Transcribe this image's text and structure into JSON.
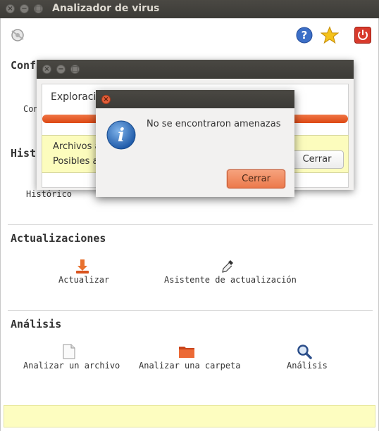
{
  "window": {
    "title": "Analizador de virus"
  },
  "header": {
    "icons": [
      "settings-icon",
      "help-icon",
      "favorite-star-icon",
      "power-icon"
    ]
  },
  "sections": {
    "configuracion": {
      "title_fragment": "Conf",
      "item_fragment": "Con"
    },
    "historico": {
      "title_fragment": "Hist",
      "item": "Histórico"
    },
    "actualizaciones": {
      "title": "Actualizaciones",
      "items": [
        "Actualizar",
        "Asistente de actualización"
      ]
    },
    "analisis": {
      "title": "Análisis",
      "items": [
        "Analizar un archivo",
        "Analizar una carpeta",
        "Análisis"
      ]
    }
  },
  "scan_dialog": {
    "heading_fragment": "Exploraci",
    "line1_fragment": "Archivos a",
    "line2_fragment": "Posibles a",
    "close_label": "Cerrar"
  },
  "message_dialog": {
    "message": "No se encontraron amenazas",
    "close_label": "Cerrar"
  },
  "colors": {
    "accent": "#dd4814",
    "info_band": "#fcfcbd"
  }
}
